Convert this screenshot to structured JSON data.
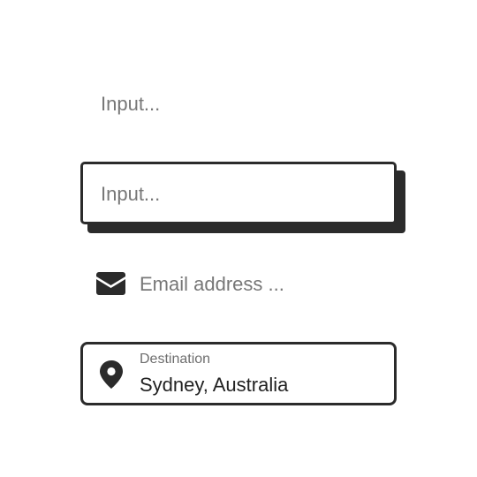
{
  "input_plain": {
    "placeholder": "Input..."
  },
  "input_shadowed": {
    "placeholder": "Input..."
  },
  "email_input": {
    "icon": "envelope-icon",
    "placeholder": "Email address ..."
  },
  "destination_input": {
    "icon": "location-pin-icon",
    "label": "Destination",
    "value": "Sydney, Australia"
  },
  "colors": {
    "border": "#2b2b2b",
    "placeholder": "#777777",
    "value_text": "#222222",
    "background": "#ffffff"
  }
}
